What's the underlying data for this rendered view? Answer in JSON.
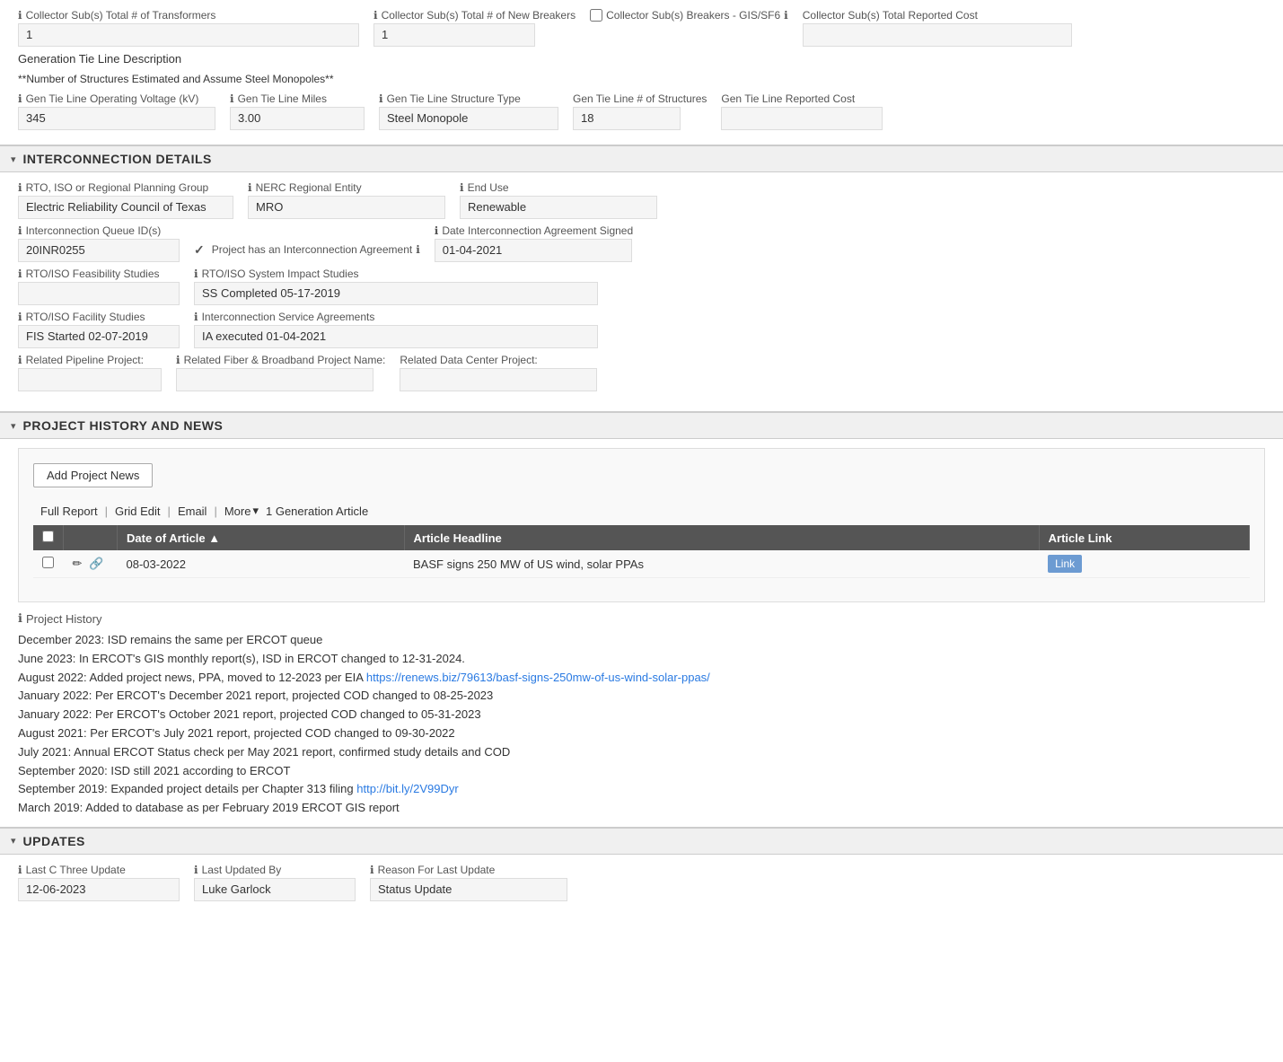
{
  "top": {
    "collector_transformers_label": "Collector Sub(s) Total # of Transformers",
    "collector_transformers_value": "1",
    "collector_breakers_label": "Collector Sub(s) Total # of New Breakers",
    "collector_breakers_value": "1",
    "collector_gis_label": "Collector Sub(s) Breakers - GIS/SF6",
    "collector_cost_label": "Collector Sub(s) Total Reported Cost",
    "collector_cost_value": "",
    "gen_tie_description_label": "Generation Tie Line Description",
    "gen_tie_note": "**Number of Structures Estimated and Assume Steel Monopoles**",
    "gen_tie_voltage_label": "Gen Tie Line Operating Voltage (kV)",
    "gen_tie_voltage_value": "345",
    "gen_tie_miles_label": "Gen Tie Line Miles",
    "gen_tie_miles_value": "3.00",
    "gen_tie_structure_label": "Gen Tie Line Structure Type",
    "gen_tie_structure_value": "Steel Monopole",
    "gen_tie_num_structures_label": "Gen Tie Line # of Structures",
    "gen_tie_num_structures_value": "18",
    "gen_tie_reported_cost_label": "Gen Tie Line Reported Cost",
    "gen_tie_reported_cost_value": ""
  },
  "interconnection": {
    "section_title": "INTERCONNECTION DETAILS",
    "rto_label": "RTO, ISO or Regional Planning Group",
    "rto_value": "Electric Reliability Council of Texas",
    "nerc_label": "NERC Regional Entity",
    "nerc_value": "MRO",
    "end_use_label": "End Use",
    "end_use_value": "Renewable",
    "queue_id_label": "Interconnection Queue ID(s)",
    "queue_id_value": "20INR0255",
    "interconnect_agreement_label": "Project has an Interconnection Agreement",
    "interconnect_agreement_checked": true,
    "date_signed_label": "Date Interconnection Agreement Signed",
    "date_signed_value": "01-04-2021",
    "feasibility_label": "RTO/ISO Feasibility Studies",
    "feasibility_value": "",
    "system_impact_label": "RTO/ISO System Impact Studies",
    "system_impact_value": "SS Completed 05-17-2019",
    "facility_label": "RTO/ISO Facility Studies",
    "facility_value": "FIS Started 02-07-2019",
    "service_agreements_label": "Interconnection Service Agreements",
    "service_agreements_value": "IA executed 01-04-2021",
    "pipeline_label": "Related Pipeline Project:",
    "pipeline_value": "",
    "fiber_label": "Related Fiber & Broadband Project Name:",
    "fiber_value": "",
    "datacenter_label": "Related Data Center Project:",
    "datacenter_value": ""
  },
  "project_history": {
    "section_title": "PROJECT HISTORY and NEWS",
    "add_news_btn": "Add Project News",
    "toolbar": {
      "full_report": "Full Report",
      "grid_edit": "Grid Edit",
      "email": "Email",
      "more": "More",
      "article_count": "1 Generation Article"
    },
    "table": {
      "headers": [
        "",
        "",
        "Date of Article",
        "Article Headline",
        "Article Link"
      ],
      "rows": [
        {
          "date": "08-03-2022",
          "headline": "BASF signs 250 MW of US wind, solar PPAs",
          "link_text": "Link"
        }
      ]
    },
    "history_label": "Project History",
    "entries": [
      {
        "text": "December 2023: ISD remains the same per ERCOT queue",
        "link": "",
        "link_text": ""
      },
      {
        "text": "June 2023: In ERCOT's GIS monthly report(s), ISD in ERCOT changed to 12-31-2024.",
        "link": "",
        "link_text": ""
      },
      {
        "text": "August 2022: Added project news, PPA, moved to 12-2023 per EIA",
        "link": "https://renews.biz/79613/basf-signs-250mw-of-us-wind-solar-ppas/",
        "link_text": "https://renews.biz/79613/basf-signs-250mw-of-us-wind-solar-ppas/"
      },
      {
        "text": "January 2022: Per ERCOT's December 2021 report,  projected COD changed to 08-25-2023",
        "link": "",
        "link_text": ""
      },
      {
        "text": "January 2022: Per ERCOT's October 2021 report,  projected COD changed to 05-31-2023",
        "link": "",
        "link_text": ""
      },
      {
        "text": "August 2021: Per ERCOT's July 2021 report,  projected COD changed to 09-30-2022",
        "link": "",
        "link_text": ""
      },
      {
        "text": "July 2021: Annual ERCOT Status check per May 2021 report, confirmed study details and COD",
        "link": "",
        "link_text": ""
      },
      {
        "text": "September 2020: ISD still 2021 according to ERCOT",
        "link": "",
        "link_text": ""
      },
      {
        "text": "September 2019: Expanded project details per Chapter 313 filing",
        "link": "http://bit.ly/2V99Dyr",
        "link_text": "http://bit.ly/2V99Dyr"
      },
      {
        "text": "March 2019: Added to database as per February 2019 ERCOT GIS report",
        "link": "",
        "link_text": ""
      }
    ]
  },
  "updates": {
    "section_title": "UPDATES",
    "last_c3_label": "Last C Three Update",
    "last_c3_value": "12-06-2023",
    "last_updated_by_label": "Last Updated By",
    "last_updated_by_value": "Luke Garlock",
    "reason_label": "Reason For Last Update",
    "reason_value": "Status Update"
  },
  "icons": {
    "info": "ℹ",
    "chevron_down": "▾",
    "checkmark": "✓"
  }
}
